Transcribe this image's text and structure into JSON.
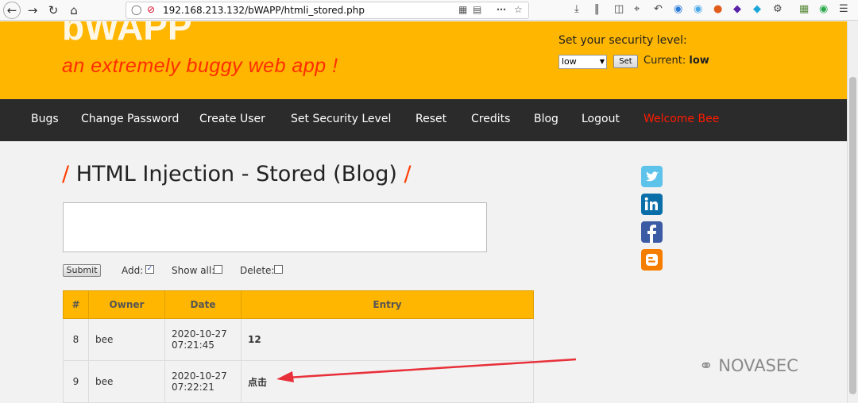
{
  "browser": {
    "url": "192.168.213.132/bWAPP/htmli_stored.php"
  },
  "header": {
    "logo": "bWAPP",
    "tagline": "an extremely buggy web app !",
    "security_label": "Set your security level:",
    "security_value": "low",
    "set_button": "Set",
    "current_label": "Current:",
    "current_value": "low"
  },
  "menu": {
    "items": [
      "Bugs",
      "Change Password",
      "Create User",
      "Set Security Level",
      "Reset",
      "Credits",
      "Blog",
      "Logout"
    ],
    "welcome": "Welcome Bee"
  },
  "main": {
    "title": "HTML Injection - Stored (Blog)",
    "submit": "Submit",
    "add_label": "Add:",
    "show_all_label": "Show all:",
    "delete_label": "Delete:",
    "add_checked": true,
    "columns": [
      "#",
      "Owner",
      "Date",
      "Entry"
    ],
    "rows": [
      {
        "id": "8",
        "owner": "bee",
        "date": "2020-10-27",
        "time": "07:21:45",
        "entry": "12"
      },
      {
        "id": "9",
        "owner": "bee",
        "date": "2020-10-27",
        "time": "07:22:21",
        "entry": "点击"
      }
    ]
  },
  "colors": {
    "header_bg": "#ffb600",
    "menu_bg": "#2b2b2b",
    "accent_red": "#ff2d00",
    "arrow": "#e8303a"
  },
  "watermark": "NOVASEC"
}
